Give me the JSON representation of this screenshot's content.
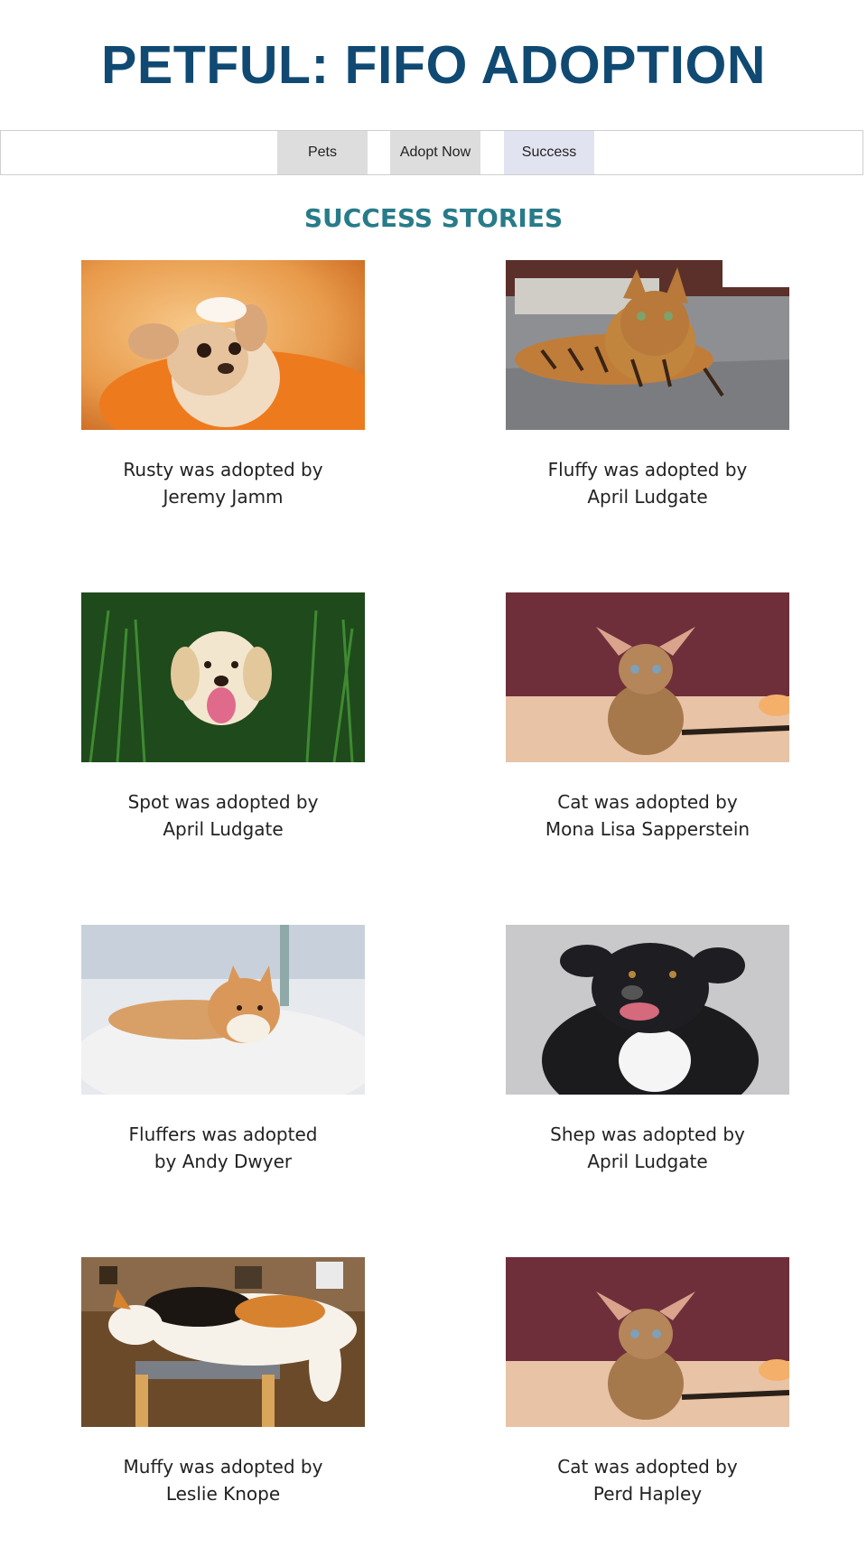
{
  "header": {
    "title": "PETFUL: FIFO ADOPTION"
  },
  "nav": {
    "pets_label": "Pets",
    "adopt_label": "Adopt Now",
    "success_label": "Success"
  },
  "main": {
    "heading": "SUCCESS STORIES",
    "stories": [
      {
        "caption": "Rusty was adopted by Jeremy Jamm"
      },
      {
        "caption": "Fluffy was adopted by April Ludgate"
      },
      {
        "caption": "Spot was adopted by April Ludgate"
      },
      {
        "caption": "Cat was adopted by Mona Lisa Sapperstein"
      },
      {
        "caption": "Fluffers was adopted by Andy Dwyer"
      },
      {
        "caption": "Shep was adopted by April Ludgate"
      },
      {
        "caption": "Muffy was adopted by Leslie Knope"
      },
      {
        "caption": "Cat was adopted by Perd Hapley"
      }
    ]
  },
  "colors": {
    "title": "#104a73",
    "heading": "#287b89",
    "nav_bg": "#dddddd",
    "nav_active_bg": "#e2e3f1"
  }
}
